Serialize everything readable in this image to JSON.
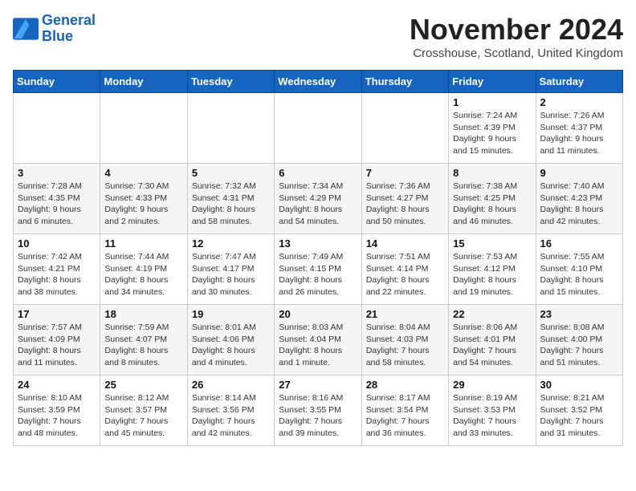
{
  "header": {
    "logo_line1": "General",
    "logo_line2": "Blue",
    "month": "November 2024",
    "location": "Crosshouse, Scotland, United Kingdom"
  },
  "days_of_week": [
    "Sunday",
    "Monday",
    "Tuesday",
    "Wednesday",
    "Thursday",
    "Friday",
    "Saturday"
  ],
  "weeks": [
    [
      {
        "day": "",
        "info": ""
      },
      {
        "day": "",
        "info": ""
      },
      {
        "day": "",
        "info": ""
      },
      {
        "day": "",
        "info": ""
      },
      {
        "day": "",
        "info": ""
      },
      {
        "day": "1",
        "info": "Sunrise: 7:24 AM\nSunset: 4:39 PM\nDaylight: 9 hours and 15 minutes."
      },
      {
        "day": "2",
        "info": "Sunrise: 7:26 AM\nSunset: 4:37 PM\nDaylight: 9 hours and 11 minutes."
      }
    ],
    [
      {
        "day": "3",
        "info": "Sunrise: 7:28 AM\nSunset: 4:35 PM\nDaylight: 9 hours and 6 minutes."
      },
      {
        "day": "4",
        "info": "Sunrise: 7:30 AM\nSunset: 4:33 PM\nDaylight: 9 hours and 2 minutes."
      },
      {
        "day": "5",
        "info": "Sunrise: 7:32 AM\nSunset: 4:31 PM\nDaylight: 8 hours and 58 minutes."
      },
      {
        "day": "6",
        "info": "Sunrise: 7:34 AM\nSunset: 4:29 PM\nDaylight: 8 hours and 54 minutes."
      },
      {
        "day": "7",
        "info": "Sunrise: 7:36 AM\nSunset: 4:27 PM\nDaylight: 8 hours and 50 minutes."
      },
      {
        "day": "8",
        "info": "Sunrise: 7:38 AM\nSunset: 4:25 PM\nDaylight: 8 hours and 46 minutes."
      },
      {
        "day": "9",
        "info": "Sunrise: 7:40 AM\nSunset: 4:23 PM\nDaylight: 8 hours and 42 minutes."
      }
    ],
    [
      {
        "day": "10",
        "info": "Sunrise: 7:42 AM\nSunset: 4:21 PM\nDaylight: 8 hours and 38 minutes."
      },
      {
        "day": "11",
        "info": "Sunrise: 7:44 AM\nSunset: 4:19 PM\nDaylight: 8 hours and 34 minutes."
      },
      {
        "day": "12",
        "info": "Sunrise: 7:47 AM\nSunset: 4:17 PM\nDaylight: 8 hours and 30 minutes."
      },
      {
        "day": "13",
        "info": "Sunrise: 7:49 AM\nSunset: 4:15 PM\nDaylight: 8 hours and 26 minutes."
      },
      {
        "day": "14",
        "info": "Sunrise: 7:51 AM\nSunset: 4:14 PM\nDaylight: 8 hours and 22 minutes."
      },
      {
        "day": "15",
        "info": "Sunrise: 7:53 AM\nSunset: 4:12 PM\nDaylight: 8 hours and 19 minutes."
      },
      {
        "day": "16",
        "info": "Sunrise: 7:55 AM\nSunset: 4:10 PM\nDaylight: 8 hours and 15 minutes."
      }
    ],
    [
      {
        "day": "17",
        "info": "Sunrise: 7:57 AM\nSunset: 4:09 PM\nDaylight: 8 hours and 11 minutes."
      },
      {
        "day": "18",
        "info": "Sunrise: 7:59 AM\nSunset: 4:07 PM\nDaylight: 8 hours and 8 minutes."
      },
      {
        "day": "19",
        "info": "Sunrise: 8:01 AM\nSunset: 4:06 PM\nDaylight: 8 hours and 4 minutes."
      },
      {
        "day": "20",
        "info": "Sunrise: 8:03 AM\nSunset: 4:04 PM\nDaylight: 8 hours and 1 minute."
      },
      {
        "day": "21",
        "info": "Sunrise: 8:04 AM\nSunset: 4:03 PM\nDaylight: 7 hours and 58 minutes."
      },
      {
        "day": "22",
        "info": "Sunrise: 8:06 AM\nSunset: 4:01 PM\nDaylight: 7 hours and 54 minutes."
      },
      {
        "day": "23",
        "info": "Sunrise: 8:08 AM\nSunset: 4:00 PM\nDaylight: 7 hours and 51 minutes."
      }
    ],
    [
      {
        "day": "24",
        "info": "Sunrise: 8:10 AM\nSunset: 3:59 PM\nDaylight: 7 hours and 48 minutes."
      },
      {
        "day": "25",
        "info": "Sunrise: 8:12 AM\nSunset: 3:57 PM\nDaylight: 7 hours and 45 minutes."
      },
      {
        "day": "26",
        "info": "Sunrise: 8:14 AM\nSunset: 3:56 PM\nDaylight: 7 hours and 42 minutes."
      },
      {
        "day": "27",
        "info": "Sunrise: 8:16 AM\nSunset: 3:55 PM\nDaylight: 7 hours and 39 minutes."
      },
      {
        "day": "28",
        "info": "Sunrise: 8:17 AM\nSunset: 3:54 PM\nDaylight: 7 hours and 36 minutes."
      },
      {
        "day": "29",
        "info": "Sunrise: 8:19 AM\nSunset: 3:53 PM\nDaylight: 7 hours and 33 minutes."
      },
      {
        "day": "30",
        "info": "Sunrise: 8:21 AM\nSunset: 3:52 PM\nDaylight: 7 hours and 31 minutes."
      }
    ]
  ]
}
